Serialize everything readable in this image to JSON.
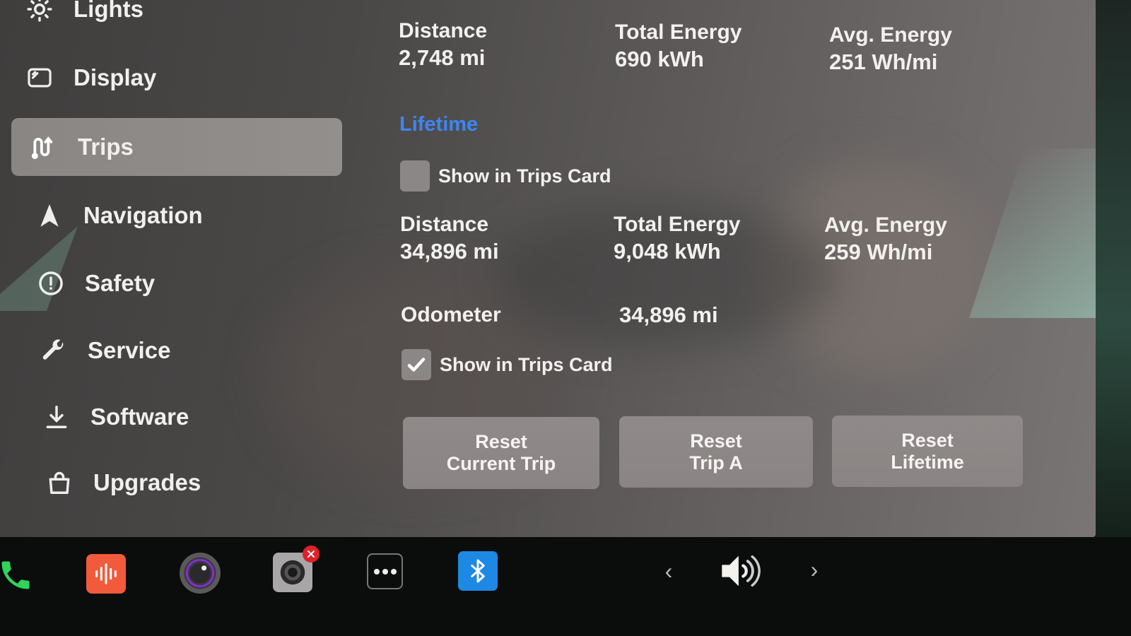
{
  "sidebar": {
    "items": [
      {
        "label": "Lights",
        "icon": "sun-icon",
        "active": false
      },
      {
        "label": "Display",
        "icon": "display-icon",
        "active": false
      },
      {
        "label": "Trips",
        "icon": "trips-icon",
        "active": true
      },
      {
        "label": "Navigation",
        "icon": "navigation-arrow-icon",
        "active": false
      },
      {
        "label": "Safety",
        "icon": "alert-circle-icon",
        "active": false
      },
      {
        "label": "Service",
        "icon": "wrench-icon",
        "active": false
      },
      {
        "label": "Software",
        "icon": "download-icon",
        "active": false
      },
      {
        "label": "Upgrades",
        "icon": "shopping-bag-icon",
        "active": false
      }
    ]
  },
  "trip_a": {
    "distance_label": "Distance",
    "distance_value": "2,748 mi",
    "total_energy_label": "Total Energy",
    "total_energy_value": "690 kWh",
    "avg_energy_label": "Avg. Energy",
    "avg_energy_value": "251 Wh/mi"
  },
  "lifetime": {
    "title": "Lifetime",
    "show_in_trips_card_label": "Show in Trips Card",
    "show_in_trips_card_checked": false,
    "distance_label": "Distance",
    "distance_value": "34,896 mi",
    "total_energy_label": "Total Energy",
    "total_energy_value": "9,048 kWh",
    "avg_energy_label": "Avg. Energy",
    "avg_energy_value": "259 Wh/mi"
  },
  "odometer": {
    "label": "Odometer",
    "value": "34,896 mi",
    "show_in_trips_card_label": "Show in Trips Card",
    "show_in_trips_card_checked": true
  },
  "buttons": {
    "reset_current_trip": {
      "line1": "Reset",
      "line2": "Current Trip"
    },
    "reset_trip_a": {
      "line1": "Reset",
      "line2": "Trip A"
    },
    "reset_lifetime": {
      "line1": "Reset",
      "line2": "Lifetime"
    }
  },
  "taskbar": {
    "icons": [
      "phone-icon",
      "audio-app-icon",
      "camera-app-icon",
      "dashcam-icon",
      "more-apps-icon",
      "bluetooth-icon"
    ],
    "volume_icon": "volume-icon",
    "prev_label": "‹",
    "next_label": "›"
  },
  "colors": {
    "accent_blue": "#3d86f2",
    "phone_green": "#2fd35a",
    "audio_orange": "#f15a3b",
    "bluetooth_blue": "#1e88e5",
    "badge_red": "#e0202a"
  }
}
